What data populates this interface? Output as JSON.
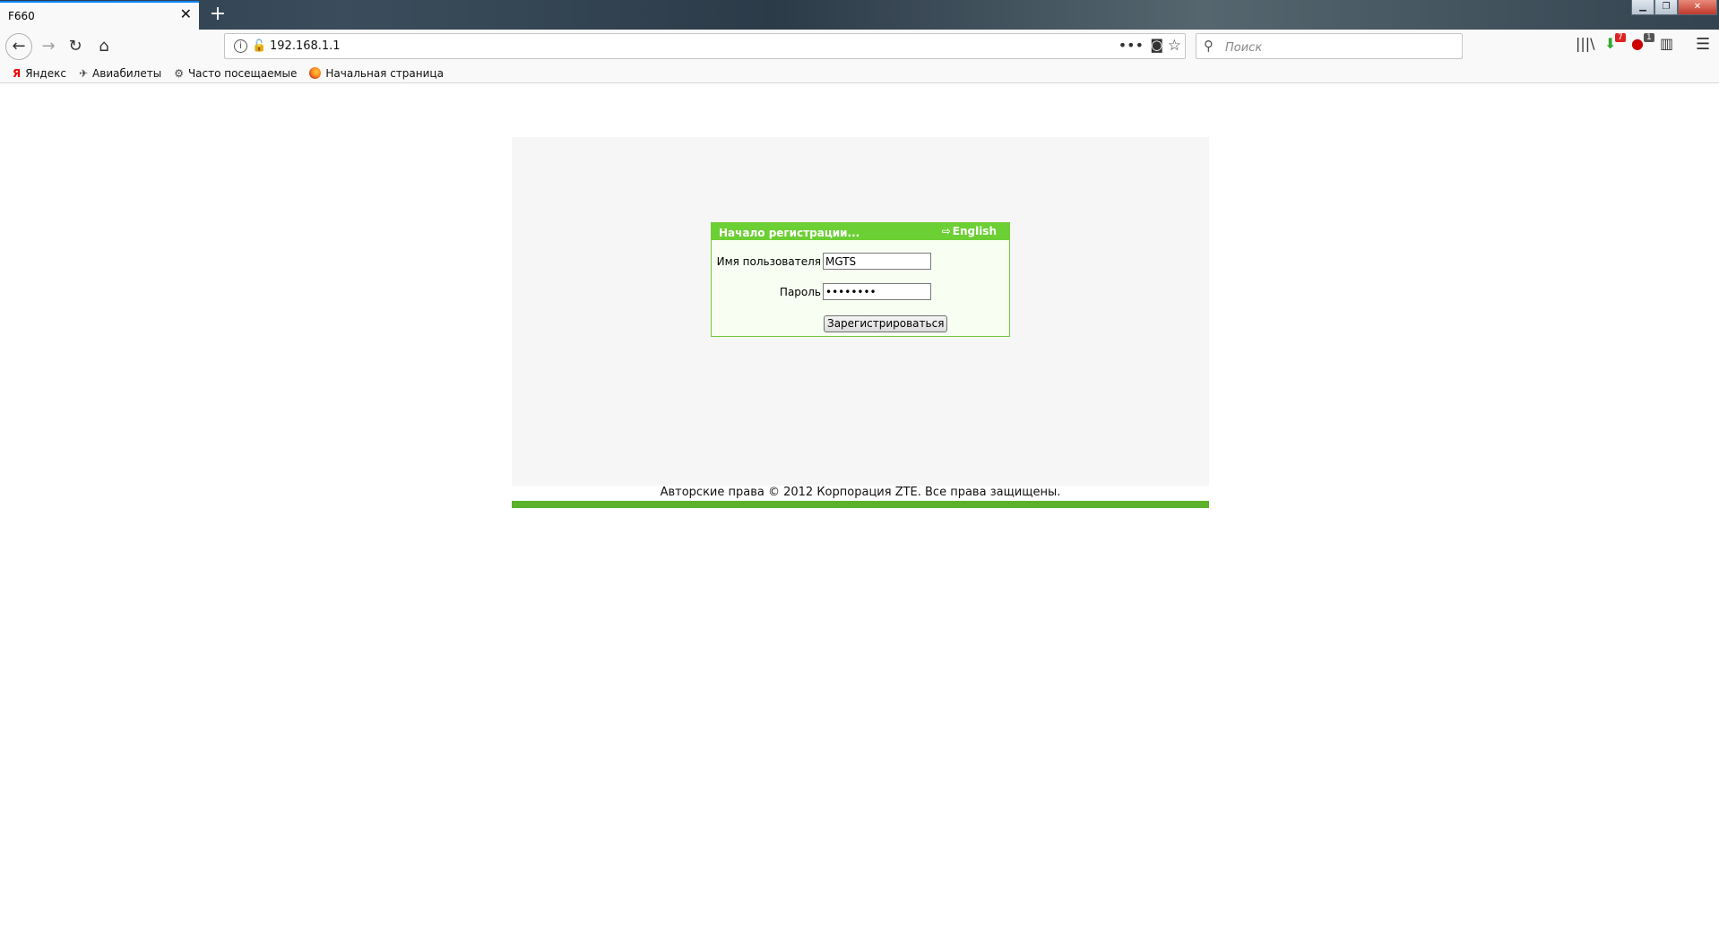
{
  "browser": {
    "tab_title": "F660",
    "tab_close": "✕",
    "new_tab": "+",
    "window_controls": {
      "minimize": "▁",
      "maximize": "❐",
      "close": "✕"
    },
    "url": "192.168.1.1",
    "search_placeholder": "Поиск",
    "page_actions": "•••",
    "download_badge": "7",
    "adblock_badge": "1",
    "icons": {
      "back": "←",
      "forward": "→",
      "reload": "↻",
      "home": "⌂",
      "info": "i",
      "insecure": "🔓",
      "pocket": "◙",
      "star": "☆",
      "search": "⚲",
      "library": "|||\\",
      "download": "⬇",
      "adblock": "●",
      "sidebar": "▥",
      "menu": "☰"
    }
  },
  "bookmarks": [
    {
      "label": "Яндекс",
      "icon": "Я"
    },
    {
      "label": "Авиабилеты",
      "icon": "✈"
    },
    {
      "label": "Часто посещаемые",
      "icon": "⚙"
    },
    {
      "label": "Начальная страница",
      "icon": ""
    }
  ],
  "login": {
    "title": "Начало регистрации...",
    "language_link": "English",
    "language_arrow": "⇨",
    "username_label": "Имя пользователя",
    "username_value": "MGTS",
    "password_label": "Пароль",
    "password_value": "••••••••",
    "submit_label": "Зарегистрироваться"
  },
  "footer": {
    "copyright": "Авторские права © 2012 Корпорация ZTE. Все права защищены."
  },
  "colors": {
    "header_green": "#6ccf34",
    "footer_green": "#5bb12a",
    "panel_bg": "#f6f6f6"
  }
}
